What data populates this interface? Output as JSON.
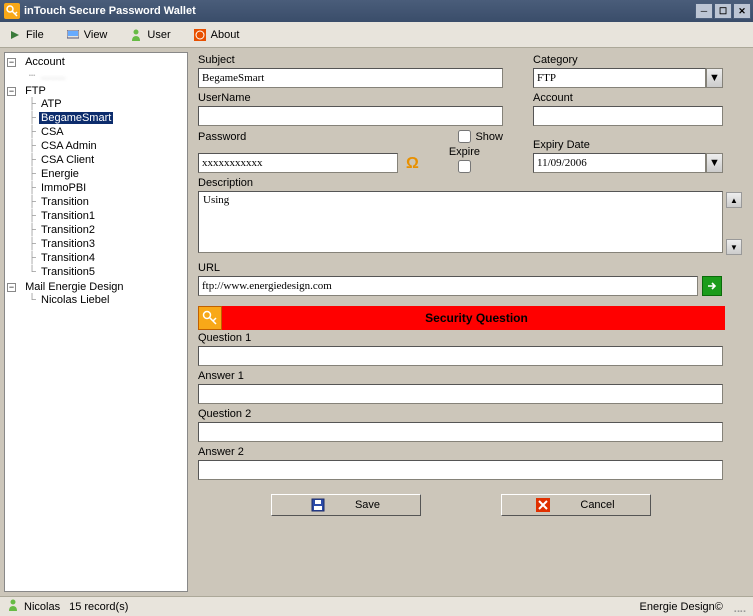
{
  "window": {
    "title": "inTouch Secure Password Wallet"
  },
  "menu": {
    "file": "File",
    "view": "View",
    "user": "User",
    "about": "About"
  },
  "tree": {
    "account": {
      "label": "Account",
      "child_blur": "........"
    },
    "ftp": {
      "label": "FTP",
      "items": [
        "ATP",
        "BegameSmart",
        "CSA",
        "CSA Admin",
        "CSA Client",
        "Energie",
        "ImmoPBI",
        "Transition",
        "Transition1",
        "Transition2",
        "Transition3",
        "Transition4",
        "Transition5"
      ],
      "selected": "BegameSmart"
    },
    "mail": {
      "label": "Mail Energie Design",
      "items": [
        "Nicolas Liebel"
      ]
    }
  },
  "form": {
    "subject": {
      "label": "Subject",
      "value": "BegameSmart"
    },
    "category": {
      "label": "Category",
      "value": "FTP"
    },
    "username": {
      "label": "UserName",
      "value": ""
    },
    "account": {
      "label": "Account",
      "value": ""
    },
    "password": {
      "label": "Password",
      "value": "xxxxxxxxxxx"
    },
    "show": {
      "label": "Show"
    },
    "expire": {
      "label": "Expire"
    },
    "expiry": {
      "label": "Expiry Date",
      "value": "11/09/2006"
    },
    "description": {
      "label": "Description",
      "value": "Using"
    },
    "url": {
      "label": "URL",
      "value": "ftp://www.energiedesign.com"
    },
    "secq": {
      "banner": "Security Question"
    },
    "question1": {
      "label": "Question 1",
      "value": ""
    },
    "answer1": {
      "label": "Answer 1",
      "value": ""
    },
    "question2": {
      "label": "Question 2",
      "value": ""
    },
    "answer2": {
      "label": "Answer 2",
      "value": ""
    },
    "save": "Save",
    "cancel": "Cancel"
  },
  "status": {
    "user": "Nicolas",
    "records": "15 record(s)",
    "copyright": "Energie Design©"
  }
}
